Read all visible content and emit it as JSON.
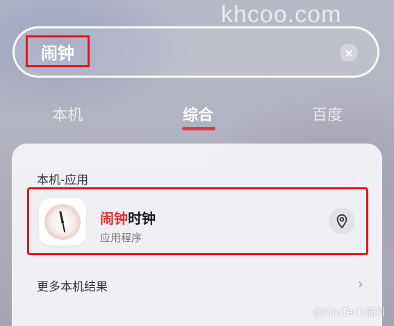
{
  "watermark_top": "khcoo.com",
  "search": {
    "value": "闹钟",
    "clear_icon": "×"
  },
  "tabs": [
    {
      "label": "本机",
      "active": false
    },
    {
      "label": "综合",
      "active": true
    },
    {
      "label": "百度",
      "active": false
    }
  ],
  "results": {
    "section_title": "本机-应用",
    "item": {
      "name_highlight": "闹钟",
      "name_rest": "时钟",
      "type": "应用程序",
      "icon": "clock-app-icon",
      "action_icon": "location-pin-icon"
    },
    "more_label": "更多本机结果",
    "more_icon": "chevron-right-icon"
  },
  "watermark_bottom": "@MiuTech喵科",
  "colors": {
    "highlight": "#e0302e",
    "annotation_border": "#e0161c",
    "tab_indicator": "#e33a4a"
  }
}
